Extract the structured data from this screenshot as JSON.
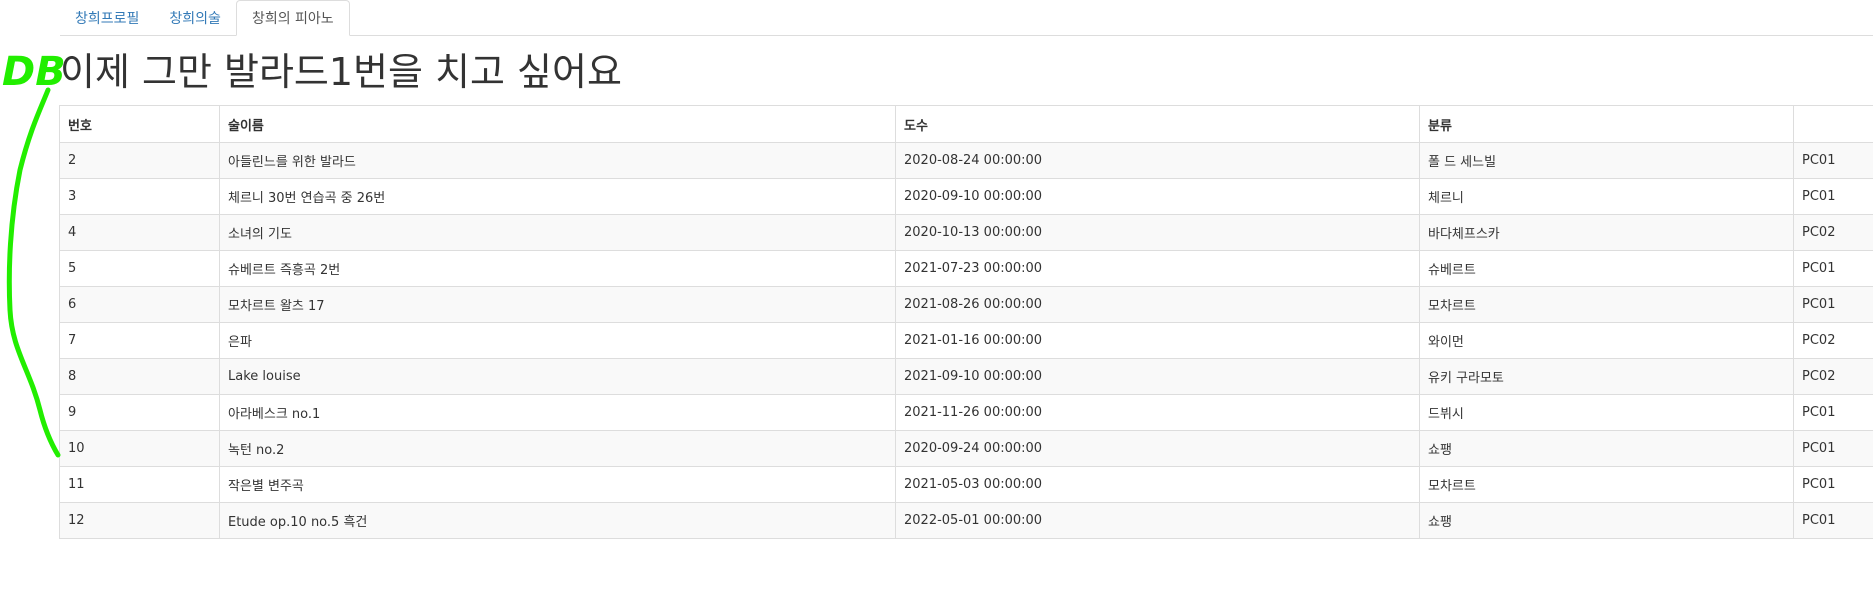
{
  "tabs": [
    {
      "label": "창희프로필",
      "active": false
    },
    {
      "label": "창희의술",
      "active": false
    },
    {
      "label": "창희의 피아노",
      "active": true
    }
  ],
  "title": "이제 그만 발라드1번을 치고 싶어요",
  "annotation": {
    "text": "DB",
    "color": "#22ee00"
  },
  "table": {
    "headers": [
      "번호",
      "술이름",
      "도수",
      "분류",
      ""
    ],
    "rows": [
      [
        "2",
        "아들린느를 위한 발라드",
        "2020-08-24 00:00:00",
        "폴 드 세느빌",
        "PC01"
      ],
      [
        "3",
        "체르니 30번 연습곡 중 26번",
        "2020-09-10 00:00:00",
        "체르니",
        "PC01"
      ],
      [
        "4",
        "소녀의 기도",
        "2020-10-13 00:00:00",
        "바다체프스카",
        "PC02"
      ],
      [
        "5",
        "슈베르트 즉흥곡 2번",
        "2021-07-23 00:00:00",
        "슈베르트",
        "PC01"
      ],
      [
        "6",
        "모차르트 왈츠 17",
        "2021-08-26 00:00:00",
        "모차르트",
        "PC01"
      ],
      [
        "7",
        "은파",
        "2021-01-16 00:00:00",
        "와이먼",
        "PC02"
      ],
      [
        "8",
        "Lake louise",
        "2021-09-10 00:00:00",
        "유키 구라모토",
        "PC02"
      ],
      [
        "9",
        "아라베스크 no.1",
        "2021-11-26 00:00:00",
        "드뷔시",
        "PC01"
      ],
      [
        "10",
        "녹턴 no.2",
        "2020-09-24 00:00:00",
        "쇼팽",
        "PC01"
      ],
      [
        "11",
        "작은별 변주곡",
        "2021-05-03 00:00:00",
        "모차르트",
        "PC01"
      ],
      [
        "12",
        "Etude op.10 no.5 흑건",
        "2022-05-01 00:00:00",
        "쇼팽",
        "PC01"
      ]
    ]
  }
}
